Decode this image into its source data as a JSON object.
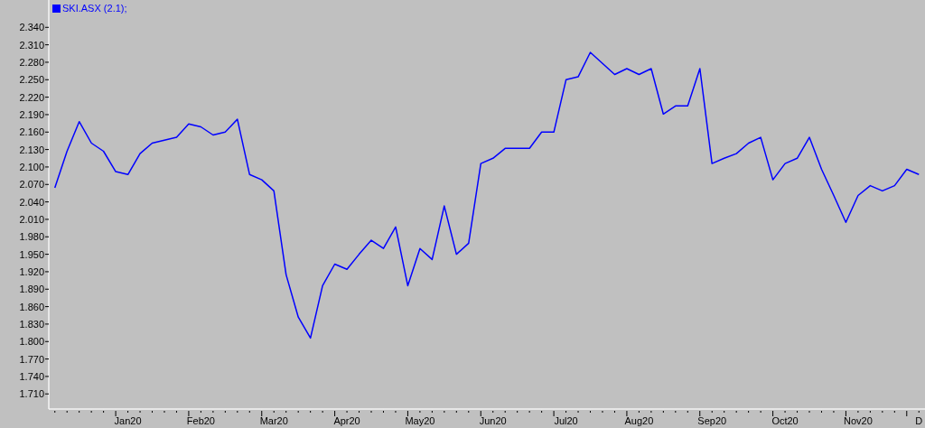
{
  "chart": {
    "chart_data": {
      "type": "line",
      "categories": [
        null,
        null,
        null,
        null,
        null,
        null,
        "Jan20",
        null,
        null,
        null,
        null,
        null,
        "Feb20",
        null,
        null,
        null,
        null,
        null,
        "Mar20",
        null,
        null,
        null,
        null,
        null,
        "Apr20",
        null,
        null,
        null,
        null,
        null,
        "May20",
        null,
        null,
        null,
        null,
        null,
        "Jun20",
        null,
        null,
        null,
        null,
        null,
        "Jul20",
        null,
        null,
        null,
        null,
        null,
        "Aug20",
        null,
        null,
        null,
        null,
        null,
        "Sep20",
        null,
        null,
        null,
        null,
        null,
        "Oct20",
        null,
        null,
        null,
        null,
        null,
        "Nov20",
        null,
        null,
        null,
        null,
        "D"
      ],
      "series": [
        {
          "name": "SKI.ASX (2.1);",
          "color": "#0000ff",
          "values": [
            2.064,
            2.127,
            2.178,
            2.141,
            2.127,
            2.092,
            2.087,
            2.123,
            2.141,
            2.146,
            2.151,
            2.174,
            2.169,
            2.155,
            2.16,
            2.182,
            2.087,
            2.078,
            2.059,
            1.915,
            1.842,
            1.806,
            1.896,
            1.933,
            1.924,
            1.95,
            1.974,
            1.96,
            1.997,
            1.896,
            1.96,
            1.941,
            2.033,
            1.95,
            1.969,
            2.106,
            2.115,
            2.132,
            2.132,
            2.132,
            2.16,
            2.16,
            2.25,
            2.255,
            2.297,
            2.278,
            2.259,
            2.269,
            2.259,
            2.269,
            2.191,
            2.205,
            2.205,
            2.269,
            2.106,
            2.115,
            2.123,
            2.141,
            2.151,
            2.078,
            2.106,
            2.115,
            2.151,
            2.096,
            2.051,
            2.005,
            2.051,
            2.068,
            2.059,
            2.068,
            2.096,
            2.087
          ]
        }
      ],
      "ylim": [
        1.684,
        2.387
      ],
      "yticks": [
        {
          "value": 2.34,
          "label": "2.340"
        },
        {
          "value": 2.31,
          "label": "2.310"
        },
        {
          "value": 2.28,
          "label": "2.280"
        },
        {
          "value": 2.25,
          "label": "2.250"
        },
        {
          "value": 2.22,
          "label": "2.220"
        },
        {
          "value": 2.19,
          "label": "2.190"
        },
        {
          "value": 2.16,
          "label": "2.160"
        },
        {
          "value": 2.13,
          "label": "2.130"
        },
        {
          "value": 2.1,
          "label": "2.100"
        },
        {
          "value": 2.07,
          "label": "2.070"
        },
        {
          "value": 2.04,
          "label": "2.040"
        },
        {
          "value": 2.01,
          "label": "2.010"
        },
        {
          "value": 1.98,
          "label": "1.980"
        },
        {
          "value": 1.95,
          "label": "1.950"
        },
        {
          "value": 1.92,
          "label": "1.920"
        },
        {
          "value": 1.89,
          "label": "1.890"
        },
        {
          "value": 1.86,
          "label": "1.860"
        },
        {
          "value": 1.83,
          "label": "1.830"
        },
        {
          "value": 1.8,
          "label": "1.800"
        },
        {
          "value": 1.77,
          "label": "1.770"
        },
        {
          "value": 1.74,
          "label": "1.740"
        },
        {
          "value": 1.71,
          "label": "1.710"
        }
      ]
    }
  }
}
